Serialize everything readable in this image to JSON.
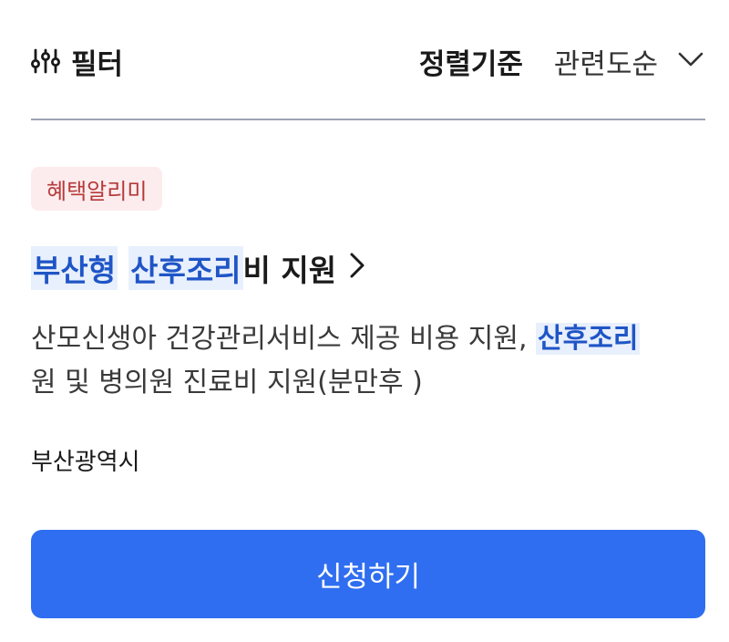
{
  "header": {
    "filter_icon": "sliders-icon",
    "filter_label": "필터",
    "sort_title": "정렬기준",
    "sort_value": "관련도순",
    "sort_icon": "chevron-down-icon"
  },
  "result": {
    "badge": "혜택알리미",
    "title": {
      "part1": "부산형",
      "part2": "산후조리",
      "part3": "비 지원",
      "chevron_icon": "chevron-right-icon"
    },
    "description": {
      "text1": "산모신생아 건강관리서비스 제공 비용 지원, ",
      "highlight": "산후조리",
      "text2": "원 및 병의원 진료비 지원(분만후 )"
    },
    "region": "부산광역시",
    "apply_label": "신청하기"
  },
  "colors": {
    "accent": "#2f6ef0",
    "highlight_text": "#1f55c6",
    "highlight_bg": "#e8f0fd",
    "badge_bg": "#fdeced",
    "badge_text": "#b53a3a",
    "divider": "#9ea3b4"
  }
}
